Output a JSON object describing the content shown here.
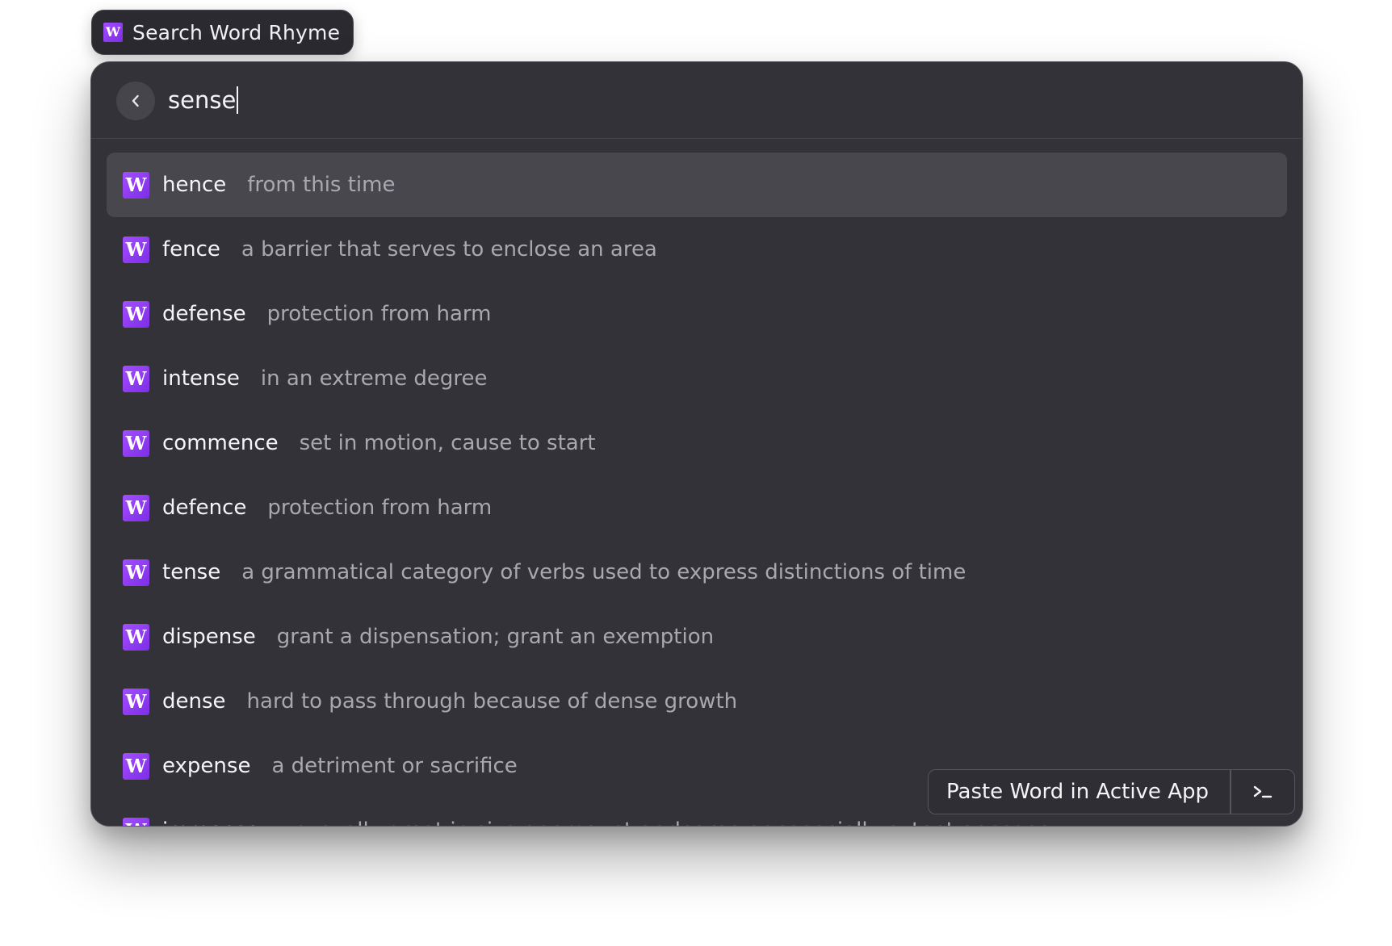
{
  "command": {
    "title": "Search Word Rhyme",
    "icon": "word-app-icon",
    "icon_glyph": "W"
  },
  "search": {
    "query": "sense",
    "back_icon": "chevron-left-icon"
  },
  "results": [
    {
      "word": "hence",
      "definition": "from this time",
      "selected": true
    },
    {
      "word": "fence",
      "definition": "a barrier that serves to enclose an area"
    },
    {
      "word": "defense",
      "definition": "protection from harm"
    },
    {
      "word": "intense",
      "definition": "in an extreme degree"
    },
    {
      "word": "commence",
      "definition": "set in motion, cause to start"
    },
    {
      "word": "defence",
      "definition": "protection from harm"
    },
    {
      "word": "tense",
      "definition": "a grammatical category of verbs used to express distinctions of time"
    },
    {
      "word": "dispense",
      "definition": "grant a dispensation; grant an exemption"
    },
    {
      "word": "dense",
      "definition": "hard to pass through because of dense growth"
    },
    {
      "word": "expense",
      "definition": "a detriment or sacrifice"
    },
    {
      "word": "immense",
      "definition": "unusually great in size or amount or degree or especially extent or scope"
    }
  ],
  "action": {
    "label": "Paste Word in Active App",
    "shortcut_icon": "terminal-prompt-icon"
  },
  "colors": {
    "panel_bg": "#333238",
    "selected_row": "#48474e",
    "icon_gradient_start": "#a44dff",
    "icon_gradient_end": "#7d2ee6"
  }
}
